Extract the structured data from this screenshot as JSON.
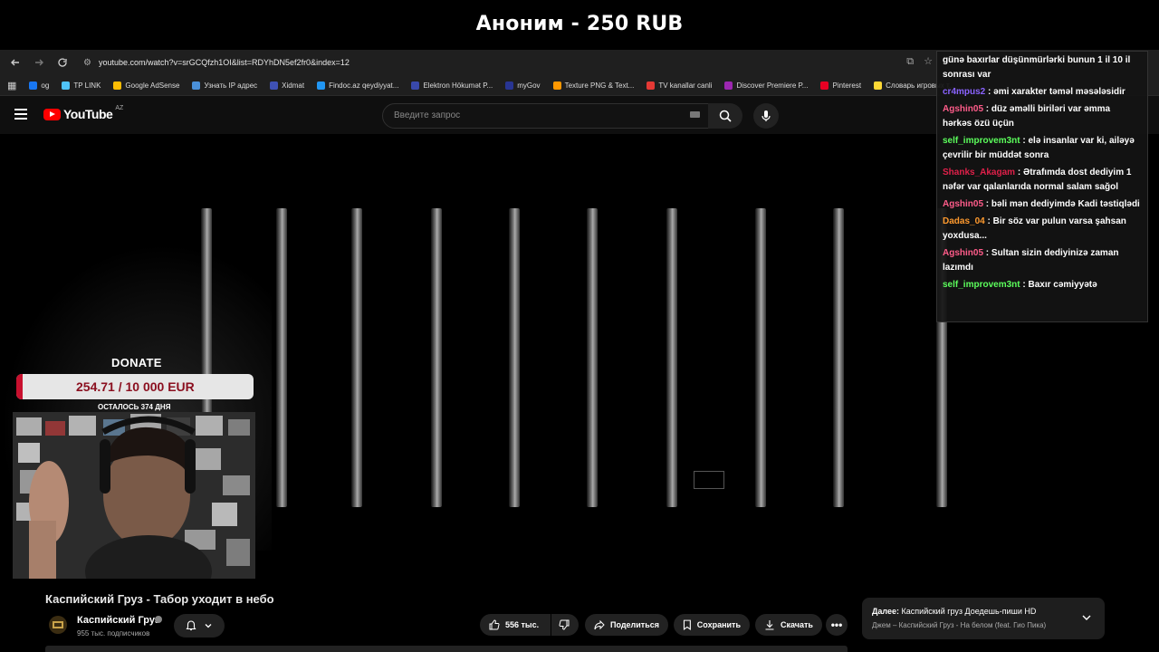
{
  "banner": {
    "text": "Аноним - 250 RUB"
  },
  "browser": {
    "url": "youtube.com/watch?v=srGCQfzh1OI&list=RDYhDN5ef2fr0&index=12",
    "bookmarks": [
      {
        "label": "og",
        "color": "#1877f2"
      },
      {
        "label": "TP LINK",
        "color": "#4fc3f7"
      },
      {
        "label": "Google AdSense",
        "color": "#fbbc04"
      },
      {
        "label": "Узнать IP адрес",
        "color": "#4a90d9"
      },
      {
        "label": "Xidmat",
        "color": "#3f51b5"
      },
      {
        "label": "Findoc.az qeydiyyat...",
        "color": "#2196f3"
      },
      {
        "label": "Elektron Hökumət P...",
        "color": "#3949ab"
      },
      {
        "label": "myGov",
        "color": "#283593"
      },
      {
        "label": "Texture PNG & Text...",
        "color": "#ff9800"
      },
      {
        "label": "TV kanallar canli",
        "color": "#e53935"
      },
      {
        "label": "Discover Premiere P...",
        "color": "#9c27b0"
      },
      {
        "label": "Pinterest",
        "color": "#e60023"
      },
      {
        "label": "Словарь игровых т...",
        "color": "#fdd835"
      }
    ]
  },
  "youtube": {
    "logo_text": "YouTube",
    "region": "AZ",
    "search_placeholder": "Введите запрос"
  },
  "donation": {
    "title": "DONATE",
    "amount": "254.71 / 10 000 EUR",
    "progress": 0.025,
    "days_left": "ОСТАЛОСЬ 374 ДНЯ"
  },
  "chat": {
    "messages": [
      {
        "user": "",
        "text": "günə baxırlar düşünmürlərki bunun 1 il 10 il sonrası var",
        "color": "#ffffff"
      },
      {
        "user": "cr4mpus2",
        "text": "əmi xarakter təməl məsələsidir",
        "color": "#8a63ff"
      },
      {
        "user": "Agshin05",
        "text": "düz əməlli biriləri var əmma hərkəs özü üçün",
        "color": "#ff5c8a"
      },
      {
        "user": "self_improvem3nt",
        "text": "elə insanlar var ki, ailəyə çevrilir bir müddət sonra",
        "color": "#5cff5c"
      },
      {
        "user": "Shanks_Akagam",
        "text": "Ətrafımda dost dediyim 1 nəfər var qalanlarıda normal salam sağol",
        "color": "#e0204a"
      },
      {
        "user": "Agshin05",
        "text": "bəli mən dediyimdə Kadi təstiqlədi",
        "color": "#ff5c8a"
      },
      {
        "user": "Dadas_04",
        "text": "Bir söz var pulun varsa şahsan yoxdusa...",
        "color": "#ff9a2e"
      },
      {
        "user": "Agshin05",
        "text": "Sultan sizin dediyinizə zaman lazımdı",
        "color": "#ff5c8a"
      },
      {
        "user": "self_improvem3nt",
        "text": "Baxır cəmiyyətə",
        "color": "#5cff5c"
      }
    ]
  },
  "video": {
    "title": "Каспийский Груз - Табор уходит в небо",
    "channel_name": "Каспийский Груз",
    "subscribers": "955 тыс. подписчиков",
    "likes": "556 тыс.",
    "share_label": "Поделиться",
    "save_label": "Сохранить",
    "download_label": "Скачать"
  },
  "up_next": {
    "prefix": "Далее:",
    "title": "Каспийский груз Доедешь-пиши HD",
    "subtitle": "Джем – Каспийский Груз - На белом (feat. Гио Пика)"
  }
}
